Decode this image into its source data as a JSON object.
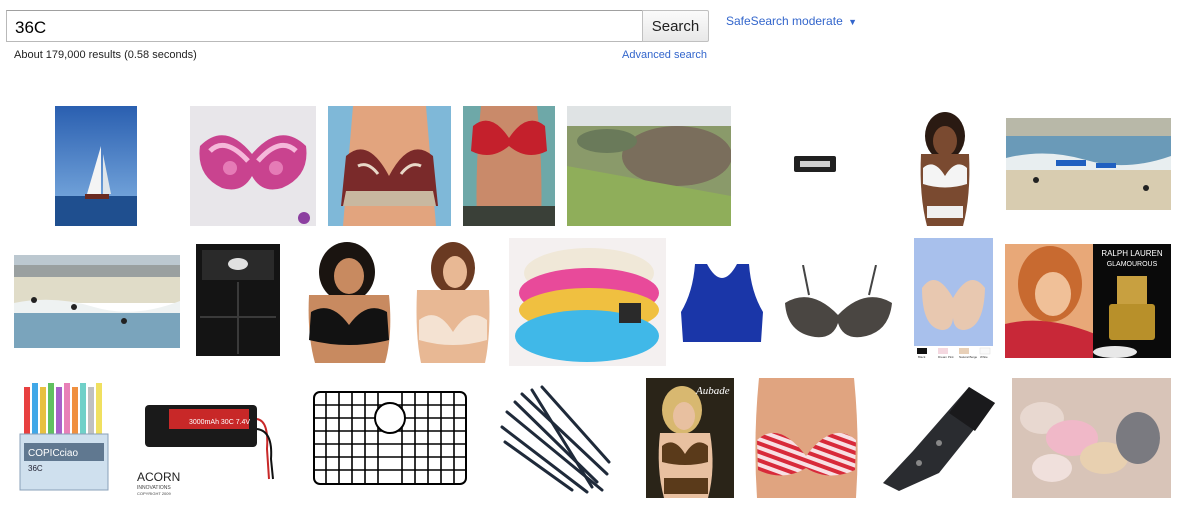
{
  "search": {
    "query": "36C",
    "button_label": "Search"
  },
  "safesearch": {
    "label": "SafeSearch moderate",
    "arrow": "▼"
  },
  "results": {
    "stats": "About 179,000 results (0.58 seconds)",
    "advanced_search": "Advanced search"
  },
  "images": [
    {
      "subject": "sailboat on sea"
    },
    {
      "subject": "pink lace bra"
    },
    {
      "subject": "paisley halter bikini top"
    },
    {
      "subject": "red bra"
    },
    {
      "subject": "aerial landscape field"
    },
    {
      "subject": "small electronic device"
    },
    {
      "subject": "woman in white bra"
    },
    {
      "subject": "beach with surfers"
    },
    {
      "subject": "beach with surfers and buildings"
    },
    {
      "subject": "black speaker cabinet"
    },
    {
      "subject": "woman in black bra"
    },
    {
      "subject": "woman in nude bra"
    },
    {
      "subject": "stack of colorful bras"
    },
    {
      "subject": "blue sports bra"
    },
    {
      "subject": "grey bra"
    },
    {
      "subject": "beige bra with color swatches"
    },
    {
      "subject": "woman and perfume bottle"
    },
    {
      "subject": "set of copic markers"
    },
    {
      "subject": "rc battery pack"
    },
    {
      "subject": "sink grid"
    },
    {
      "subject": "cable ties"
    },
    {
      "subject": "lingerie advertisement"
    },
    {
      "subject": "striped bikini top"
    },
    {
      "subject": "knife in sheath"
    },
    {
      "subject": "bras on sheet"
    }
  ],
  "image_text": {
    "perfume_brand": "RALPH LAUREN",
    "perfume_name": "GLAMOUROUS",
    "marker_brand": "COPICciao",
    "marker_count": "36C",
    "battery_label": "3000mAh 30C 7.4V",
    "battery_brand": "ACORN",
    "battery_sub": "INNOVATIONS",
    "battery_copyright": "COPYRIGHT 2009",
    "lingerie_brand": "Aubade",
    "swatch_1": "Black",
    "swatch_2": "Dream Pink",
    "swatch_3": "Natural Beige",
    "swatch_4": "White"
  },
  "colors": {
    "link": "#3366cc",
    "text": "#222222",
    "button_border": "#c0c0c0"
  }
}
